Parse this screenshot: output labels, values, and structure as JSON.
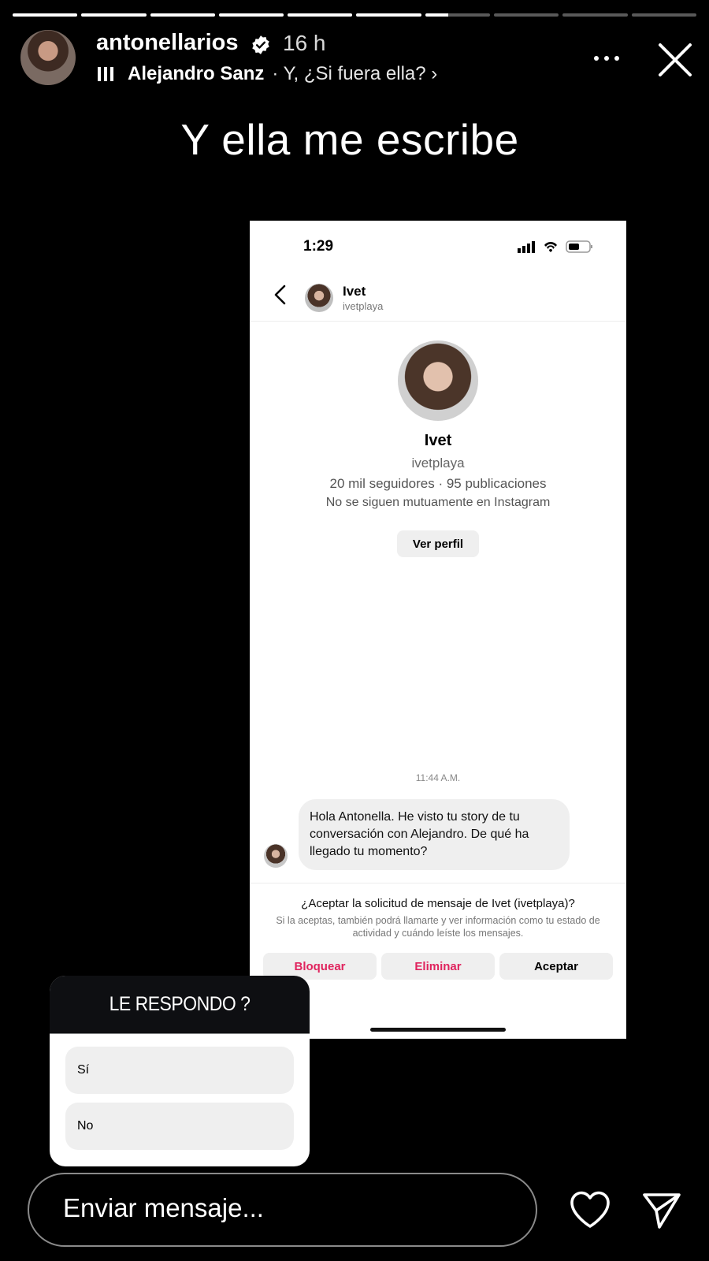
{
  "progress": {
    "segments": 10,
    "completed": 6,
    "current_fill": 0.35
  },
  "header": {
    "username": "antonellarios",
    "verified": true,
    "time_ago": "16 h",
    "music_artist": "Alejandro Sanz",
    "music_song": "· Y, ¿Si fuera ella? ›",
    "icons": {
      "more": "more-horizontal-icon",
      "close": "close-icon",
      "verified": "verified-badge-icon",
      "music": "music-bars-icon"
    }
  },
  "caption": "Y ella me escribe",
  "screenshot": {
    "status_time": "1:29",
    "chat_name": "Ivet",
    "chat_handle": "ivetplaya",
    "profile_name": "Ivet",
    "profile_handle": "ivetplaya",
    "profile_stats": "20 mil seguidores · 95 publicaciones",
    "mutual_text": "No se siguen mutuamente en Instagram",
    "view_profile_label": "Ver perfil",
    "message_time": "11:44 A.M.",
    "message_text": "Hola Antonella. He visto tu story de tu conversación con Alejandro. De qué ha llegado tu momento?",
    "request_title": "¿Aceptar la solicitud de mensaje de Ivet (ivetplaya)?",
    "request_desc": "Si la aceptas, también podrá llamarte y ver información como tu estado de actividad y cuándo leíste los mensajes.",
    "actions": {
      "block": "Bloquear",
      "delete": "Eliminar",
      "accept": "Aceptar"
    },
    "accent_red": "#e0245e"
  },
  "poll": {
    "question": "LE RESPONDO ?",
    "options": [
      "Sí",
      "No"
    ]
  },
  "footer": {
    "message_placeholder": "Enviar mensaje...",
    "icons": {
      "like": "heart-icon",
      "share": "paper-plane-icon"
    }
  }
}
